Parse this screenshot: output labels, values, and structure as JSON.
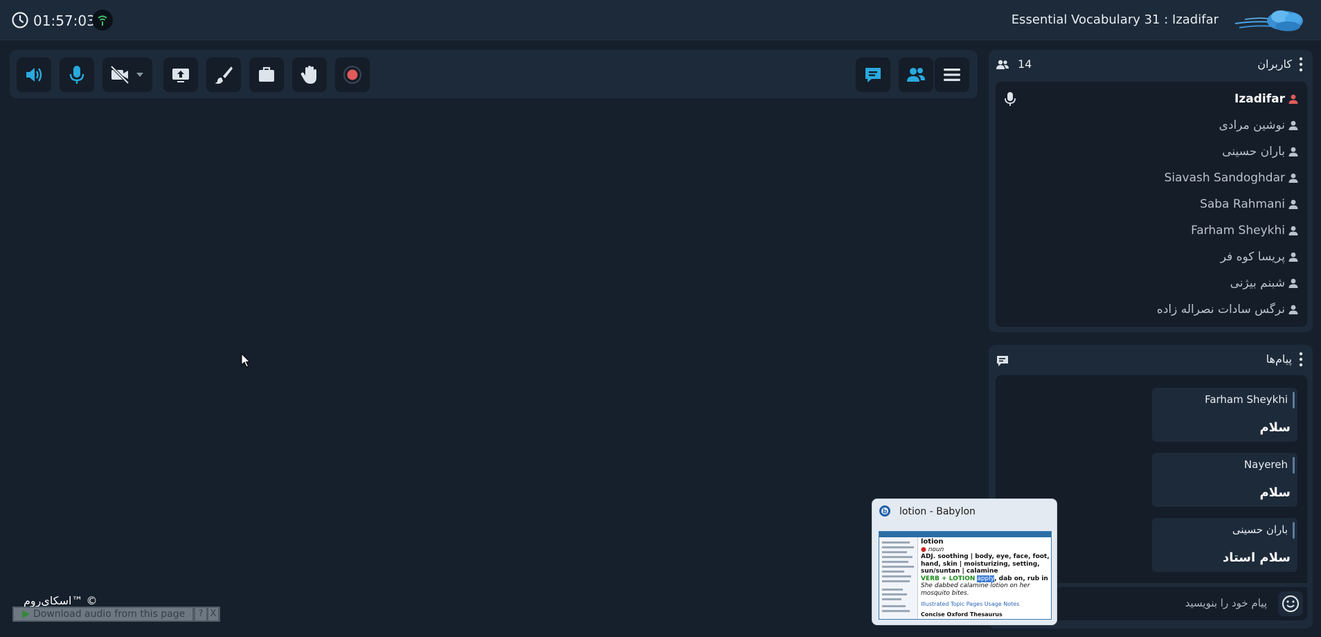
{
  "header": {
    "elapsed_time": "01:57:03",
    "room_title": "Essential Vocabulary 31 : Izadifar"
  },
  "toolbar": {
    "left_buttons": [
      "speaker",
      "microphone",
      "camera-off",
      "share-screen",
      "whiteboard",
      "files",
      "raise-hand",
      "record"
    ],
    "right_buttons": [
      "chat",
      "users",
      "menu"
    ],
    "accent_color": "#29a9df",
    "record_color": "#e05a5a"
  },
  "users_panel": {
    "title": "کاربران",
    "count": "14",
    "users": [
      {
        "name": "Izadifar",
        "is_host": true
      },
      {
        "name": "نوشین مرادی"
      },
      {
        "name": "باران حسینی"
      },
      {
        "name": "Siavash Sandoghdar"
      },
      {
        "name": "Saba Rahmani"
      },
      {
        "name": "Farham Sheykhi"
      },
      {
        "name": "پریسا کوه فر"
      },
      {
        "name": "شبنم بیژنی"
      },
      {
        "name": "نرگس سادات نصراله زاده"
      }
    ]
  },
  "messages_panel": {
    "title": "پیام‌ها",
    "messages": [
      {
        "sender": "Farham Sheykhi",
        "text": "سلام"
      },
      {
        "sender": "Nayereh",
        "text": "سلام"
      },
      {
        "sender": "باران حسینی",
        "text": "سلام استاد"
      }
    ],
    "input_placeholder": "پیام خود را بنویسید"
  },
  "taskbar_preview": {
    "title": "lotion - Babylon",
    "entry_word": "lotion",
    "part_of_speech": "noun",
    "adj_line": "ADJ. soothing | body, eye, face, foot, hand, skin | moisturizing, setting, sun/suntan | calamine",
    "verb_label": "VERB + LOTION",
    "verb_highlight": "apply",
    "verb_rest": ", dab on, rub in",
    "example": "She dabbed calamine lotion on her mosquito bites.",
    "links": "Illustrated Topic Pages   Usage Notes",
    "source": "Concise Oxford Thesaurus"
  },
  "footer": {
    "brand": "اسکای‌روم™ ©",
    "download_label": "Download audio from this page",
    "help_label": "?",
    "close_label": "X"
  }
}
